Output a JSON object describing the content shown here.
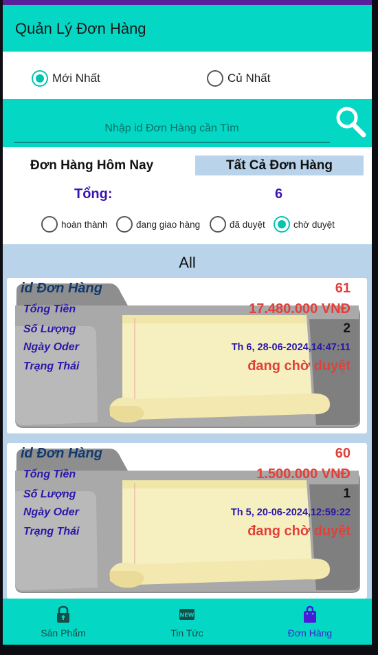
{
  "app": {
    "title": "Quản Lý Đơn Hàng",
    "accent_color": "#04d7c4",
    "status_bar_color": "#5a1f9a"
  },
  "sort": {
    "newest_label": "Mới Nhất",
    "oldest_label": "Củ Nhất",
    "selected": "newest"
  },
  "search": {
    "placeholder": "Nhập id Đơn Hàng cần Tìm",
    "value": "",
    "icon": "search-icon"
  },
  "tabs": {
    "today_label": "Đơn Hàng Hôm Nay",
    "all_label": "Tất Cả Đơn Hàng",
    "selected": "all"
  },
  "summary": {
    "total_label": "Tổng:",
    "total_value": "6"
  },
  "status_filter": {
    "options": [
      "hoàn thành",
      "đang giao hàng",
      "đã duyệt",
      "chờ duyệt"
    ],
    "selected": "chờ duyệt"
  },
  "list": {
    "title": "All",
    "field_labels": {
      "id": "id Đơn Hàng",
      "total": "Tổng Tiền",
      "quantity": "Số Lượng",
      "date": "Ngày Oder",
      "status": "Trạng Thái"
    },
    "orders": [
      {
        "id": "61",
        "total": "17.480.000 VNĐ",
        "quantity": "2",
        "date": "Th 6, 28-06-2024,14:47:11",
        "status": "đang chờ duyệt"
      },
      {
        "id": "60",
        "total": "1.500.000 VNĐ",
        "quantity": "1",
        "date": "Th 5, 20-06-2024,12:59:22",
        "status": "đang chờ duyệt"
      }
    ]
  },
  "bottom_nav": {
    "items": [
      {
        "label": "Sản Phẩm",
        "icon": "lock-icon"
      },
      {
        "label": "Tin Tức",
        "icon": "news-icon"
      },
      {
        "label": "Đơn Hàng",
        "icon": "shopping-bag-icon"
      }
    ],
    "active": "Đơn Hàng",
    "active_color": "#4a1ad8"
  }
}
